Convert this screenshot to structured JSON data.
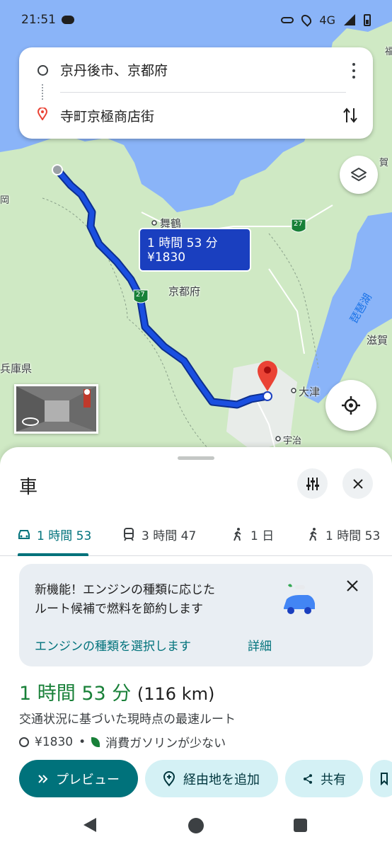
{
  "status_bar": {
    "time": "21:51",
    "network": "4G"
  },
  "search": {
    "origin": "京丹後市、京都府",
    "destination": "寺町京極商店街"
  },
  "map": {
    "labels": {
      "maizuru": "舞鶴",
      "kyoto_pref": "京都府",
      "hyogo": "兵庫県",
      "oka": "岡",
      "otsu": "大津",
      "uji": "宇治",
      "shiga": "滋賀",
      "biwako": "琵琶湖",
      "ga": "賀",
      "route_27a": "27",
      "route_27b": "27",
      "fu": "福"
    },
    "route_callout": {
      "time": "1 時間 53 分",
      "cost": "¥1830"
    },
    "colors": {
      "water": "#8ab4f8",
      "land": "#cfe9c4",
      "route": "#1a3fbf"
    }
  },
  "sheet": {
    "title": "車",
    "tabs": [
      {
        "icon": "car-icon",
        "label": "1 時間 53"
      },
      {
        "icon": "train-icon",
        "label": "3 時間 47"
      },
      {
        "icon": "walk-icon",
        "label": "1 日"
      },
      {
        "icon": "bike-icon",
        "label": "1 時間 53"
      }
    ],
    "promo": {
      "line1": "新機能！エンジンの種類に応じた",
      "line2": "ルート候補で燃料を節約します",
      "link_select": "エンジンの種類を選択します",
      "link_details": "詳細"
    },
    "route": {
      "duration": "1 時間 53 分",
      "distance": "(116 km)",
      "description": "交通状況に基づいた現時点の最速ルート",
      "toll": "¥1830",
      "separator": "•",
      "fuel_note": "消費ガソリンが少ない"
    },
    "actions": {
      "preview": "プレビュー",
      "add_waypoint": "経由地を追加",
      "share": "共有"
    }
  }
}
